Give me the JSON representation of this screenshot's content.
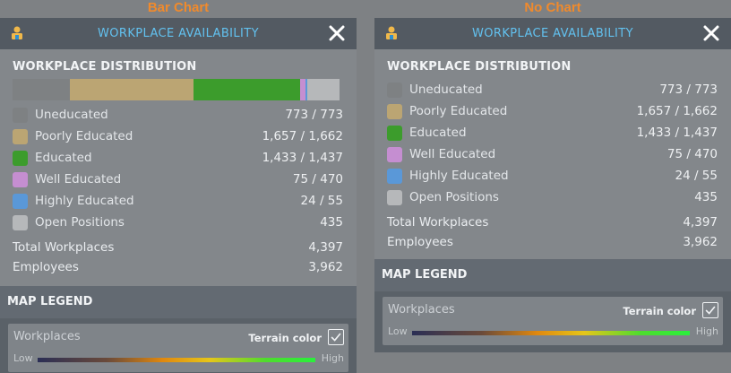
{
  "captions": {
    "left": "Bar Chart",
    "right": "No Chart"
  },
  "colors": {
    "uneducated": "#7e8183",
    "poorly_educated": "#bba573",
    "educated": "#3c9c2c",
    "well_educated": "#c58ed1",
    "highly_educated": "#5a98d8",
    "open_positions": "#b6b8ba",
    "title": "#62c1ef",
    "caption": "#f08a2c"
  },
  "panels": [
    {
      "title": "WORKPLACE AVAILABILITY",
      "section": "WORKPLACE DISTRIBUTION",
      "rows": [
        {
          "label": "Uneducated",
          "value": "773 / 773"
        },
        {
          "label": "Poorly Educated",
          "value": "1,657 / 1,662"
        },
        {
          "label": "Educated",
          "value": "1,433 / 1,437"
        },
        {
          "label": "Well Educated",
          "value": "75 / 470"
        },
        {
          "label": "Highly Educated",
          "value": "24 / 55"
        },
        {
          "label": "Open Positions",
          "value": "435"
        }
      ],
      "totals": [
        {
          "label": "Total Workplaces",
          "value": "4,397"
        },
        {
          "label": "Employees",
          "value": "3,962"
        }
      ],
      "legend": {
        "header": "MAP LEGEND",
        "title": "Workplaces",
        "terrain": "Terrain color",
        "terrain_checked": true,
        "low": "Low",
        "high": "High"
      }
    },
    {
      "title": "WORKPLACE AVAILABILITY",
      "section": "WORKPLACE DISTRIBUTION",
      "rows": [
        {
          "label": "Uneducated",
          "value": "773 / 773"
        },
        {
          "label": "Poorly Educated",
          "value": "1,657 / 1,662"
        },
        {
          "label": "Educated",
          "value": "1,433 / 1,437"
        },
        {
          "label": "Well Educated",
          "value": "75 / 470"
        },
        {
          "label": "Highly Educated",
          "value": "24 / 55"
        },
        {
          "label": "Open Positions",
          "value": "435"
        }
      ],
      "totals": [
        {
          "label": "Total Workplaces",
          "value": "4,397"
        },
        {
          "label": "Employees",
          "value": "3,962"
        }
      ],
      "legend": {
        "header": "MAP LEGEND",
        "title": "Workplaces",
        "terrain": "Terrain color",
        "terrain_checked": true,
        "low": "Low",
        "high": "High"
      }
    }
  ],
  "chart_data": {
    "type": "bar",
    "stacked": true,
    "orientation": "horizontal",
    "categories": [
      "Uneducated",
      "Poorly Educated",
      "Educated",
      "Well Educated",
      "Highly Educated",
      "Open Positions"
    ],
    "values": [
      773,
      1657,
      1433,
      75,
      24,
      435
    ],
    "total": 4397
  }
}
